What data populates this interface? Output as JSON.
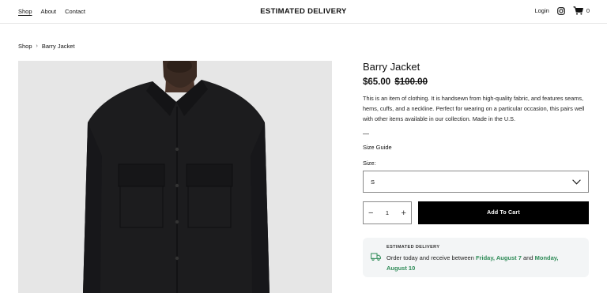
{
  "header": {
    "nav": [
      {
        "label": "Shop",
        "active": true
      },
      {
        "label": "About",
        "active": false
      },
      {
        "label": "Contact",
        "active": false
      }
    ],
    "brand": "ESTIMATED DELIVERY",
    "login_label": "Login",
    "cart_count": "0",
    "icons": [
      "instagram-icon",
      "cart-icon"
    ]
  },
  "breadcrumb": {
    "items": [
      "Shop",
      "Barry Jacket"
    ],
    "separator": "›"
  },
  "product": {
    "title": "Barry Jacket",
    "price": "$65.00",
    "compare_price": "$100.00",
    "description": "This is an item of clothing. It is handsewn from high-quality fabric, and features seams, hems, cuffs, and a neckline. Perfect for wearing on a particular occasion, this pairs well with other items available in our collection. Made in the U.S.",
    "dash": "—",
    "size_guide_label": "Size Guide",
    "size_label": "Size:",
    "size_selected": "S",
    "quantity": "1",
    "qty_minus": "−",
    "qty_plus": "+",
    "add_to_cart_label": "Add To Cart"
  },
  "delivery": {
    "heading": "ESTIMATED DELIVERY",
    "text_before": "Order today and receive between ",
    "date_start": "Friday, August 7",
    "text_middle": " and ",
    "date_end": "Monday, August 10",
    "accent_color": "#2e8b57"
  }
}
